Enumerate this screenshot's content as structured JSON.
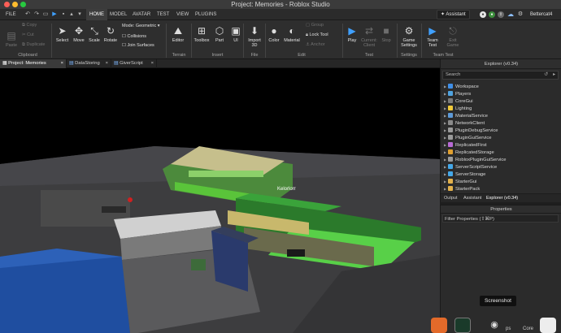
{
  "window": {
    "title": "Project: Memories - Roblox Studio"
  },
  "menubar": {
    "file": "FILE",
    "tabs": [
      "HOME",
      "MODEL",
      "AVATAR",
      "TEST",
      "VIEW",
      "PLUGINS"
    ],
    "assistant": "Assistant",
    "username": "Bettercat4"
  },
  "ribbon": {
    "clipboard": {
      "paste": "Paste",
      "copy": "Copy",
      "cut": "Cut",
      "duplicate": "Duplicate",
      "label": "Clipboard"
    },
    "tools": {
      "select": "Select",
      "move": "Move",
      "scale": "Scale",
      "rotate": "Rotate",
      "label": "Tools"
    },
    "mode": {
      "label": "Mode:",
      "value": "Geometric",
      "collisions": "Collisions",
      "join_surfaces": "Join Surfaces"
    },
    "terrain": {
      "editor": "Editor",
      "label": "Terrain"
    },
    "insert": {
      "toolbox": "Toolbox",
      "part": "Part",
      "ui": "UI",
      "label": "Insert"
    },
    "file": {
      "import": "Import",
      "import2": "3D",
      "label": "File"
    },
    "edit": {
      "color": "Color",
      "material": "Material",
      "group": "Group",
      "lock": "Lock Tool",
      "anchor": "Anchor",
      "label": "Edit"
    },
    "test": {
      "play": "Play",
      "current": "Current:",
      "client": "Client",
      "stop": "Stop",
      "label": "Test"
    },
    "settings": {
      "game": "Game",
      "settings": "Settings",
      "label": "Settings"
    },
    "team_test": {
      "team": "Team",
      "test": "Test",
      "exit": "Exit",
      "game": "Game",
      "label": "Team Test"
    }
  },
  "doc_tabs": [
    "Project: Memories",
    "DataStoring",
    "GiverScript"
  ],
  "viewport": {
    "nametag": "Kelorlorr",
    "tooltip": "Screenshot"
  },
  "explorer": {
    "title": "Explorer (v0.34)",
    "search_placeholder": "Search",
    "items": [
      {
        "label": "Workspace",
        "color": "#3f8ee6"
      },
      {
        "label": "Players",
        "color": "#4fa3e0"
      },
      {
        "label": "CoreGui",
        "color": "#7b7b7b"
      },
      {
        "label": "Lighting",
        "color": "#f0c93a"
      },
      {
        "label": "MaterialService",
        "color": "#5d9ad8"
      },
      {
        "label": "NetworkClient",
        "color": "#8a8a8a"
      },
      {
        "label": "PluginDebugService",
        "color": "#9a9a9a"
      },
      {
        "label": "PluginGuiService",
        "color": "#9a9a9a"
      },
      {
        "label": "ReplicatedFirst",
        "color": "#b96bd6"
      },
      {
        "label": "ReplicatedStorage",
        "color": "#e0a030"
      },
      {
        "label": "RobloxPluginGuiService",
        "color": "#9a9a9a"
      },
      {
        "label": "ServerScriptService",
        "color": "#45a8e8"
      },
      {
        "label": "ServerStorage",
        "color": "#45a8e8"
      },
      {
        "label": "StarterGui",
        "color": "#e2b14c"
      },
      {
        "label": "StarterPack",
        "color": "#e2b14c"
      }
    ],
    "tabs": [
      "Output",
      "Assistant",
      "Explorer (v0.34)"
    ]
  },
  "properties": {
    "title": "Properties",
    "filter": "Filter Properties (⇧⌘P)"
  },
  "dock": {
    "label1": "ps",
    "label2": "Core"
  }
}
